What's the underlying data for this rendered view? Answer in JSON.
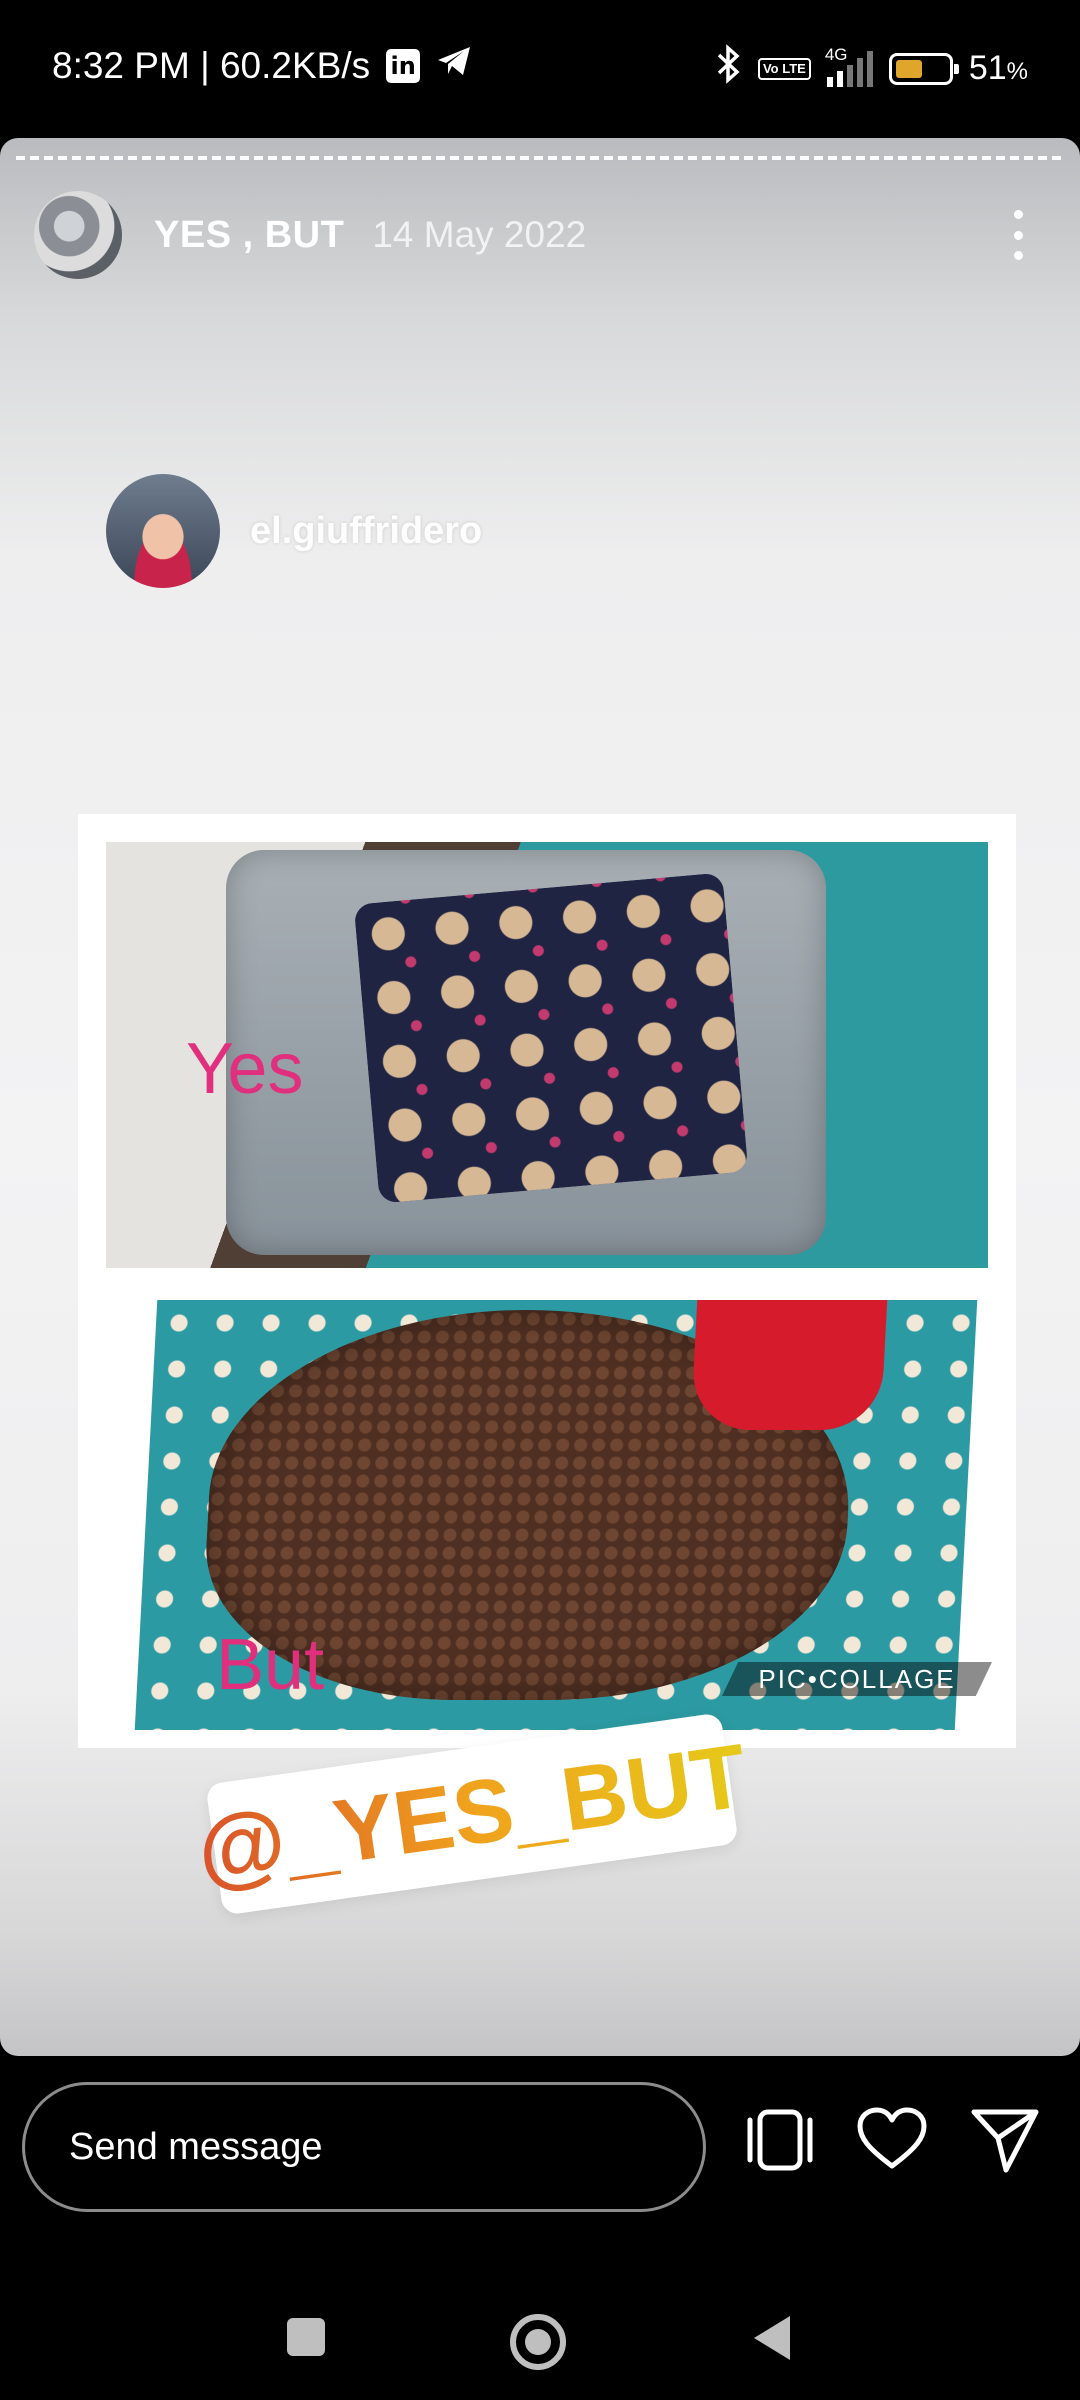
{
  "status_bar": {
    "time_speed": "8:32 PM | 60.2KB/s",
    "linkedin_icon": "linkedin-icon",
    "telegram_icon": "telegram-icon",
    "bluetooth_icon": "bluetooth-icon",
    "volte_label": "Vo LTE",
    "network_label": "4G",
    "battery_level": 0.51,
    "battery_label": "51",
    "battery_unit": "%"
  },
  "story": {
    "username": "YES , BUT",
    "date": "14 May 2022",
    "mention_username": "el.giuffridero",
    "caption_top": "Yes",
    "caption_bottom": "But",
    "collage_badge": "PIC•COLLAGE",
    "mention_sticker": "@_YES_BUT"
  },
  "reply_bar": {
    "placeholder": "Send message"
  },
  "colors": {
    "accent_pink": "#e0307d",
    "sticker_orange": "#d8522a",
    "sticker_yellow": "#e6c91a"
  }
}
